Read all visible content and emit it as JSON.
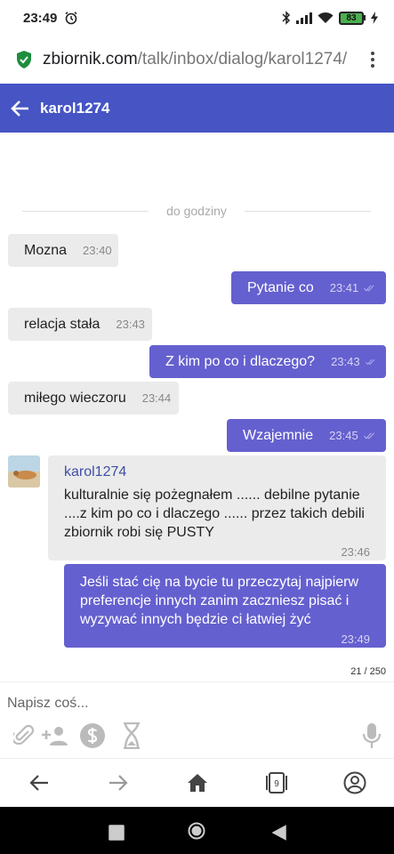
{
  "status": {
    "time": "23:49",
    "battery": "83"
  },
  "browser": {
    "domain": "zbiornik.com",
    "path": "/talk/inbox/dialog/karol1274/"
  },
  "header": {
    "title": "karol1274"
  },
  "chat": {
    "date_separator": "do godziny",
    "messages": [
      {
        "dir": "in",
        "text": "Mozna",
        "time": "23:40"
      },
      {
        "dir": "out",
        "text": "Pytanie co",
        "time": "23:41"
      },
      {
        "dir": "in",
        "text": "relacja stała",
        "time": "23:43"
      },
      {
        "dir": "out",
        "text": "Z kim po co i dlaczego?",
        "time": "23:43"
      },
      {
        "dir": "in",
        "text": "miłego wieczoru",
        "time": "23:44"
      },
      {
        "dir": "out",
        "text": "Wzajemnie",
        "time": "23:45"
      }
    ],
    "card_in": {
      "sender": "karol1274",
      "text": "kulturalnie się pożegnałem ...... debilne pytanie ....z kim po co i dlaczego ...... przez takich debili zbiornik robi się PUSTY",
      "time": "23:46"
    },
    "card_out": {
      "text": "Jeśli stać cię na bycie tu przeczytaj najpierw preferencje innych zanim zaczniesz pisać i wyzywać innych będzie ci łatwiej żyć",
      "time": "23:49"
    },
    "char_count": "21 / 250"
  },
  "composer": {
    "placeholder": "Napisz coś..."
  },
  "nav_badge": "9",
  "colors": {
    "header": "#4654c4",
    "outgoing": "#6560cf",
    "incoming": "#ebebeb",
    "lock": "#1e8e3e"
  }
}
